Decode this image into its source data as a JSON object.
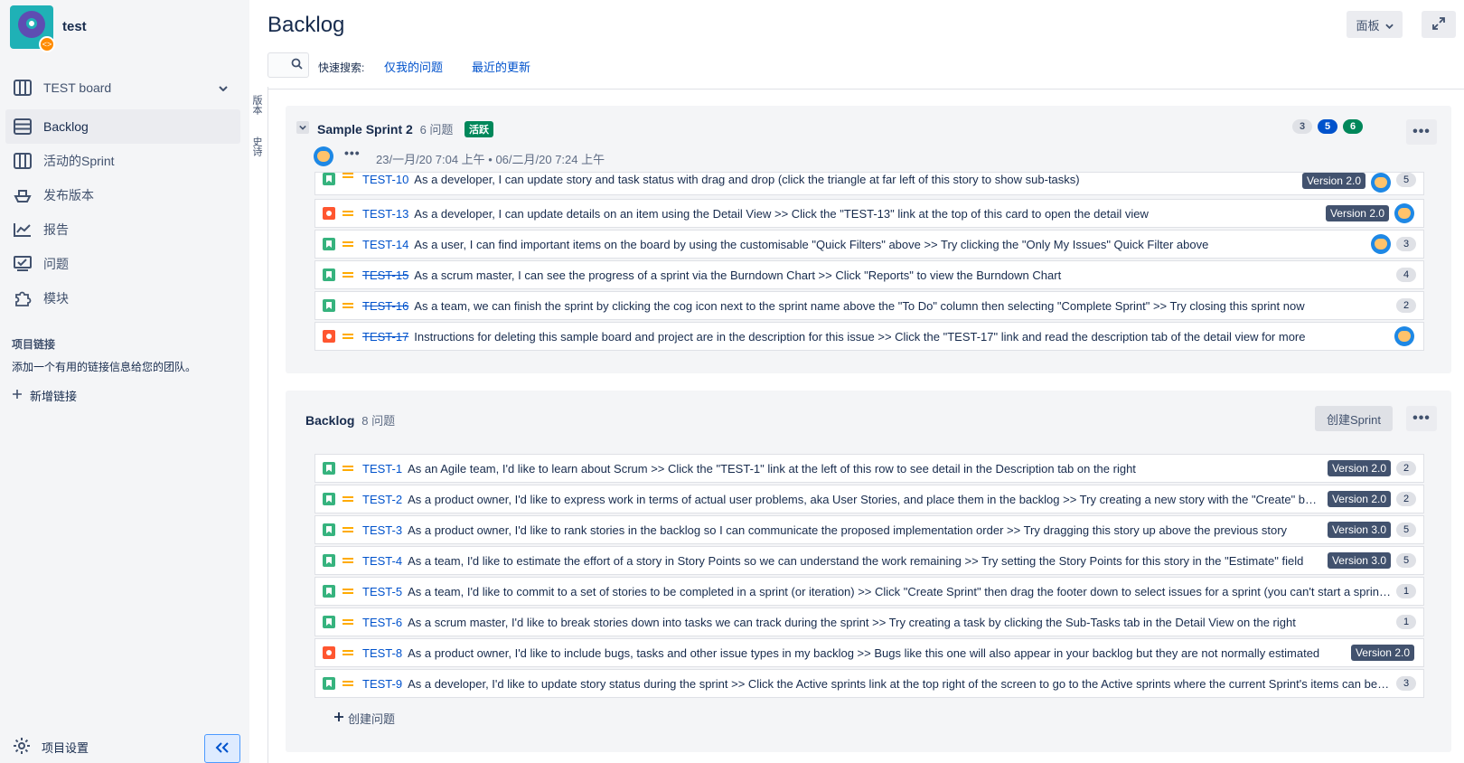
{
  "project": {
    "name": "test"
  },
  "sidebar": {
    "board_name": "TEST board",
    "items": [
      {
        "label": "Backlog",
        "icon": "backlog-icon"
      },
      {
        "label": "活动的Sprint",
        "icon": "board-icon"
      },
      {
        "label": "发布版本",
        "icon": "ship-icon"
      },
      {
        "label": "报告",
        "icon": "graph-icon"
      },
      {
        "label": "问题",
        "icon": "issues-icon"
      },
      {
        "label": "模块",
        "icon": "puzzle-icon"
      }
    ],
    "links_title": "项目链接",
    "links_desc": "添加一个有用的链接信息给您的团队。",
    "add_link": "新增链接",
    "settings": "项目设置"
  },
  "vertical_tabs": [
    "版本",
    "史诗"
  ],
  "header": {
    "title": "Backlog",
    "board_button": "面板",
    "quick_search_label": "快速搜索:",
    "quick_filters": [
      "仅我的问题",
      "最近的更新"
    ]
  },
  "sprint": {
    "name": "Sample Sprint 2",
    "count": "6 问题",
    "status": "活跃",
    "dates": "23/一月/20 7:04 上午 • 06/二月/20 7:24 上午",
    "pills": [
      "3",
      "5",
      "6"
    ],
    "rows": [
      {
        "type": "story",
        "key": "TEST-10",
        "done": false,
        "summary": "As a developer, I can update story and task status with drag and drop (click the triangle at far left of this story to show sub-tasks)",
        "version": "Version 2.0",
        "avatar": true,
        "points": "5"
      },
      {
        "type": "bug",
        "key": "TEST-13",
        "done": false,
        "summary": "As a developer, I can update details on an item using the Detail View >> Click the \"TEST-13\" link at the top of this card to open the detail view",
        "version": "Version 2.0",
        "avatar": true,
        "points": ""
      },
      {
        "type": "story",
        "key": "TEST-14",
        "done": false,
        "summary": "As a user, I can find important items on the board by using the customisable \"Quick Filters\" above >> Try clicking the \"Only My Issues\" Quick Filter above",
        "version": "",
        "avatar": true,
        "points": "3"
      },
      {
        "type": "story",
        "key": "TEST-15",
        "done": true,
        "summary": "As a scrum master, I can see the progress of a sprint via the Burndown Chart >> Click \"Reports\" to view the Burndown Chart",
        "version": "",
        "avatar": false,
        "points": "4"
      },
      {
        "type": "story",
        "key": "TEST-16",
        "done": true,
        "summary": "As a team, we can finish the sprint by clicking the cog icon next to the sprint name above the \"To Do\" column then selecting \"Complete Sprint\" >> Try closing this sprint now",
        "version": "",
        "avatar": false,
        "points": "2"
      },
      {
        "type": "bug",
        "key": "TEST-17",
        "done": true,
        "summary": "Instructions for deleting this sample board and project are in the description for this issue >> Click the \"TEST-17\" link and read the description tab of the detail view for more",
        "version": "",
        "avatar": true,
        "points": ""
      }
    ]
  },
  "backlog": {
    "title": "Backlog",
    "count": "8 问题",
    "create_sprint": "创建Sprint",
    "create_issue": "创建问题",
    "rows": [
      {
        "type": "story",
        "key": "TEST-1",
        "summary": "As an Agile team, I'd like to learn about Scrum >> Click the \"TEST-1\" link at the left of this row to see detail in the Description tab on the right",
        "version": "Version 2.0",
        "points": "2"
      },
      {
        "type": "story",
        "key": "TEST-2",
        "summary": "As a product owner, I'd like to express work in terms of actual user problems, aka User Stories, and place them in the backlog >> Try creating a new story with the \"Create\" button",
        "version": "Version 2.0",
        "points": "2"
      },
      {
        "type": "story",
        "key": "TEST-3",
        "summary": "As a product owner, I'd like to rank stories in the backlog so I can communicate the proposed implementation order >> Try dragging this story up above the previous story",
        "version": "Version 3.0",
        "points": "5"
      },
      {
        "type": "story",
        "key": "TEST-4",
        "summary": "As a team, I'd like to estimate the effort of a story in Story Points so we can understand the work remaining >> Try setting the Story Points for this story in the \"Estimate\" field",
        "version": "Version 3.0",
        "points": "5"
      },
      {
        "type": "story",
        "key": "TEST-5",
        "summary": "As a team, I'd like to commit to a set of stories to be completed in a sprint (or iteration) >> Click \"Create Sprint\" then drag the footer down to select issues for a sprint (you can't start a sprint at the moment)",
        "version": "",
        "points": "1"
      },
      {
        "type": "story",
        "key": "TEST-6",
        "summary": "As a scrum master, I'd like to break stories down into tasks we can track during the sprint >> Try creating a task by clicking the Sub-Tasks tab in the Detail View on the right",
        "version": "",
        "points": "1"
      },
      {
        "type": "bug",
        "key": "TEST-8",
        "summary": "As a product owner, I'd like to include bugs, tasks and other issue types in my backlog >> Bugs like this one will also appear in your backlog but they are not normally estimated",
        "version": "Version 2.0",
        "points": ""
      },
      {
        "type": "story",
        "key": "TEST-9",
        "summary": "As a developer, I'd like to update story status during the sprint >> Click the Active sprints link at the top right of the screen to go to the Active sprints where the current Sprint's items can be updated",
        "version": "",
        "points": "3"
      }
    ]
  },
  "colors": {
    "accent": "#0052CC",
    "story": "#36B37E",
    "bug": "#FF5630",
    "active_tag": "#00875A",
    "version_tag": "#42526E"
  }
}
